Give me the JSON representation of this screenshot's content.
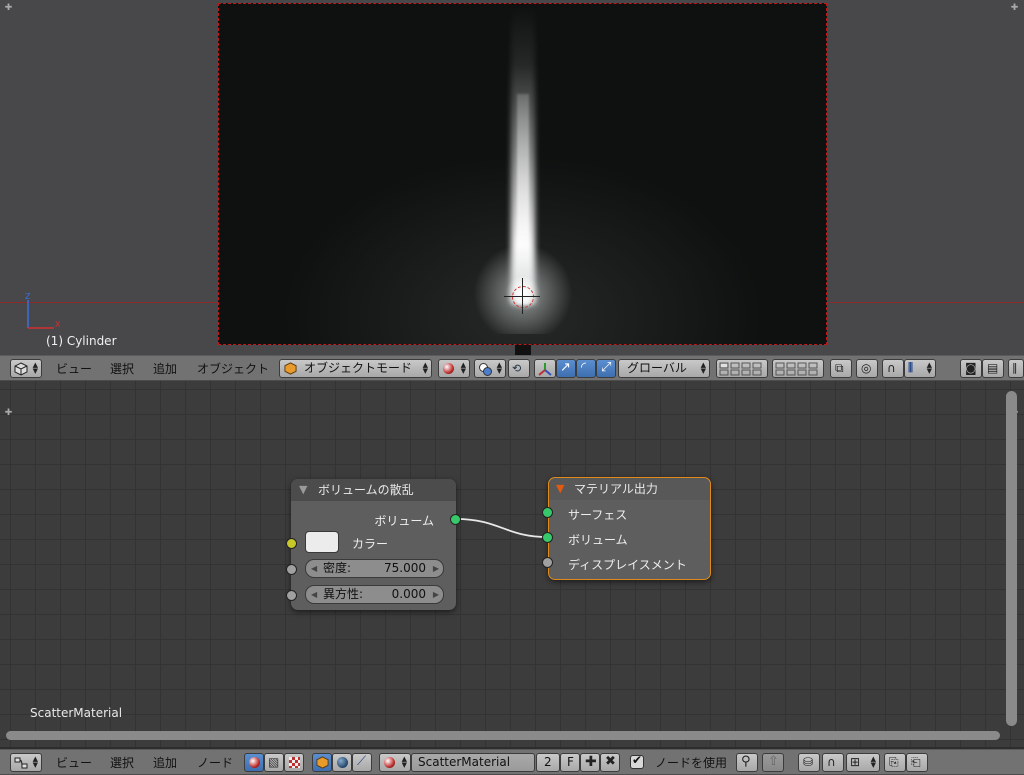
{
  "viewport": {
    "object_label": "(1) Cylinder"
  },
  "view3d_header": {
    "menus": [
      "ビュー",
      "選択",
      "追加",
      "オブジェクト"
    ],
    "mode": "オブジェクトモード",
    "orientation": "グローバル"
  },
  "node_editor": {
    "material_label": "ScatterMaterial",
    "scatter_node": {
      "title": "ボリュームの散乱",
      "output_volume": "ボリューム",
      "color_label": "カラー",
      "color_value": "#ececec",
      "density_label": "密度:",
      "density_value": "75.000",
      "anisotropy_label": "異方性:",
      "anisotropy_value": "0.000"
    },
    "output_node": {
      "title": "マテリアル出力",
      "surface": "サーフェス",
      "volume": "ボリューム",
      "displacement": "ディスプレイスメント"
    }
  },
  "node_header": {
    "menus": [
      "ビュー",
      "選択",
      "追加",
      "ノード"
    ],
    "material_name": "ScatterMaterial",
    "user_count": "2",
    "fake_user": "F",
    "use_nodes_label": "ノードを使用",
    "use_nodes_checked": true
  },
  "colors": {
    "socket_shader": "#36c86a",
    "socket_color": "#c8c82a",
    "output_node_border": "#e08a1e",
    "camera_border": "#c01818"
  }
}
